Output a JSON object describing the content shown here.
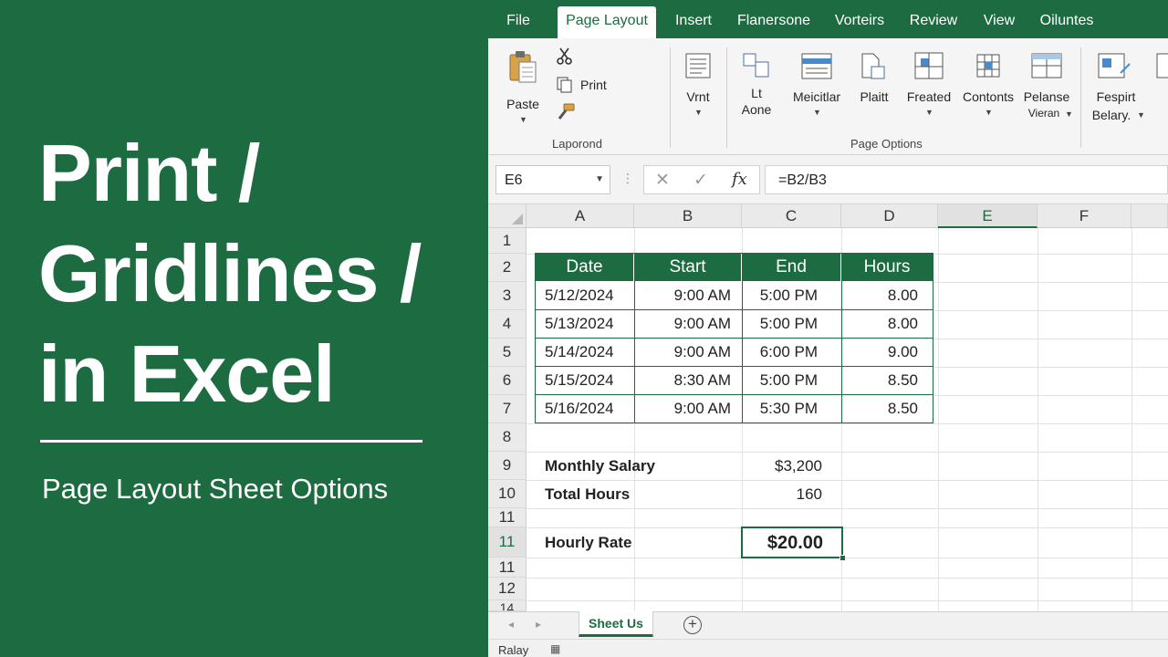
{
  "promo": {
    "title_line_1": "Print /",
    "title_line_2": "Gridlines /",
    "title_line_3": "in Excel",
    "subtitle": "Page Layout Sheet Options"
  },
  "colors": {
    "excel_green": "#1d6b41",
    "header_gray": "#eaeaea",
    "ribbon_bg": "#f5f5f5"
  },
  "menu": {
    "tabs": [
      "File",
      "Page Layout",
      "Insert",
      "Flanersone",
      "Vorteirs",
      "Review",
      "View",
      "Oiluntes"
    ],
    "active": "Page Layout"
  },
  "ribbon": {
    "paste_label": "Paste",
    "print_label": "Print",
    "clipboard_group_label": "Laporond",
    "vrnt_label": "Vrnt",
    "lt_label_1": "Lt",
    "lt_label_2": "Aone",
    "meicitlar_label": "Meicitlar",
    "plaitt_label": "Plaitt",
    "freated_label": "Freated",
    "contonts_label": "Contonts",
    "pelanse_label_1": "Pelanse",
    "pelanse_label_2": "Vieran",
    "fespirt_label_1": "Fespirt",
    "fespirt_label_2": "Belary.",
    "page_options_group_label": "Page Options"
  },
  "formula_bar": {
    "name_box": "E6",
    "formula": "=B2/B3",
    "fx_label": "fx"
  },
  "grid": {
    "columns": [
      "A",
      "B",
      "C",
      "D",
      "E",
      "F"
    ],
    "selected_column": "E",
    "row_labels": [
      "1",
      "2",
      "3",
      "4",
      "5",
      "6",
      "7",
      "8",
      "9",
      "10",
      "11",
      "11",
      "11",
      "12",
      "14"
    ],
    "selected_row_label": "11"
  },
  "table": {
    "headers": [
      "Date",
      "Start",
      "End",
      "Hours"
    ],
    "rows": [
      [
        "5/12/2024",
        "9:00 AM",
        "5:00 PM",
        "8.00"
      ],
      [
        "5/13/2024",
        "9:00 AM",
        "5:00 PM",
        "8.00"
      ],
      [
        "5/14/2024",
        "9:00 AM",
        "6:00 PM",
        "9.00"
      ],
      [
        "5/15/2024",
        "8:30 AM",
        "5:00 PM",
        "8.50"
      ],
      [
        "5/16/2024",
        "9:00 AM",
        "5:30 PM",
        "8.50"
      ]
    ]
  },
  "summary": {
    "monthly_salary_label": "Monthly Salary",
    "monthly_salary_value": "$3,200",
    "total_hours_label": "Total Hours",
    "total_hours_value": "160",
    "hourly_rate_label": "Hourly Rate",
    "hourly_rate_value": "$20.00"
  },
  "sheets": {
    "active_tab": "Sheet Us",
    "add_label": "+"
  },
  "status": {
    "text": "Ralay"
  }
}
